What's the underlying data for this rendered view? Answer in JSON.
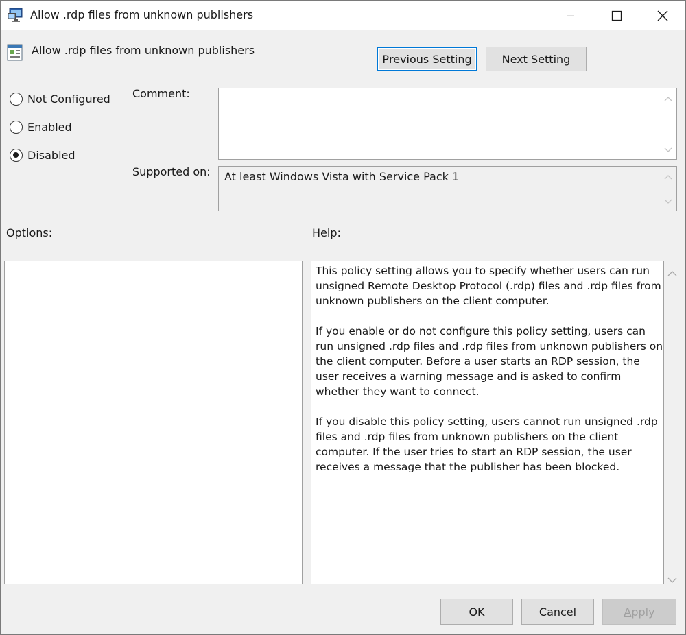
{
  "window": {
    "title": "Allow .rdp files from unknown publishers",
    "controls": [
      "minimize",
      "maximize",
      "close"
    ]
  },
  "header": {
    "title": "Allow .rdp files from unknown publishers",
    "icon": "policy-setting-icon"
  },
  "nav": {
    "previous": {
      "pre": "",
      "u": "P",
      "post": "revious Setting"
    },
    "next": {
      "pre": "",
      "u": "N",
      "post": "ext Setting"
    }
  },
  "state": {
    "options": [
      {
        "pre": "Not ",
        "u": "C",
        "post": "onfigured",
        "checked": false
      },
      {
        "pre": "",
        "u": "E",
        "post": "nabled",
        "checked": false
      },
      {
        "pre": "",
        "u": "D",
        "post": "isabled",
        "checked": true
      }
    ]
  },
  "comment": {
    "label": "Comment:",
    "value": ""
  },
  "supported": {
    "label": "Supported on:",
    "value": "At least Windows Vista with Service Pack 1"
  },
  "options_panel": {
    "label": "Options:"
  },
  "help_panel": {
    "label": "Help:",
    "paragraphs": [
      "This policy setting allows you to specify whether users can run unsigned Remote Desktop Protocol (.rdp) files and .rdp files from unknown publishers on the client computer.",
      "If you enable or do not configure this policy setting, users can run unsigned .rdp files and .rdp files from unknown publishers on the client computer. Before a user starts an RDP session, the user receives a warning message and is asked to confirm whether they want to connect.",
      "If you disable this policy setting, users cannot run unsigned .rdp files and .rdp files from unknown publishers on the client computer. If the user tries to start an RDP session, the user receives a message that the publisher has been blocked."
    ]
  },
  "footer": {
    "ok": "OK",
    "cancel": "Cancel",
    "apply": {
      "pre": "",
      "u": "A",
      "post": "pply"
    }
  }
}
